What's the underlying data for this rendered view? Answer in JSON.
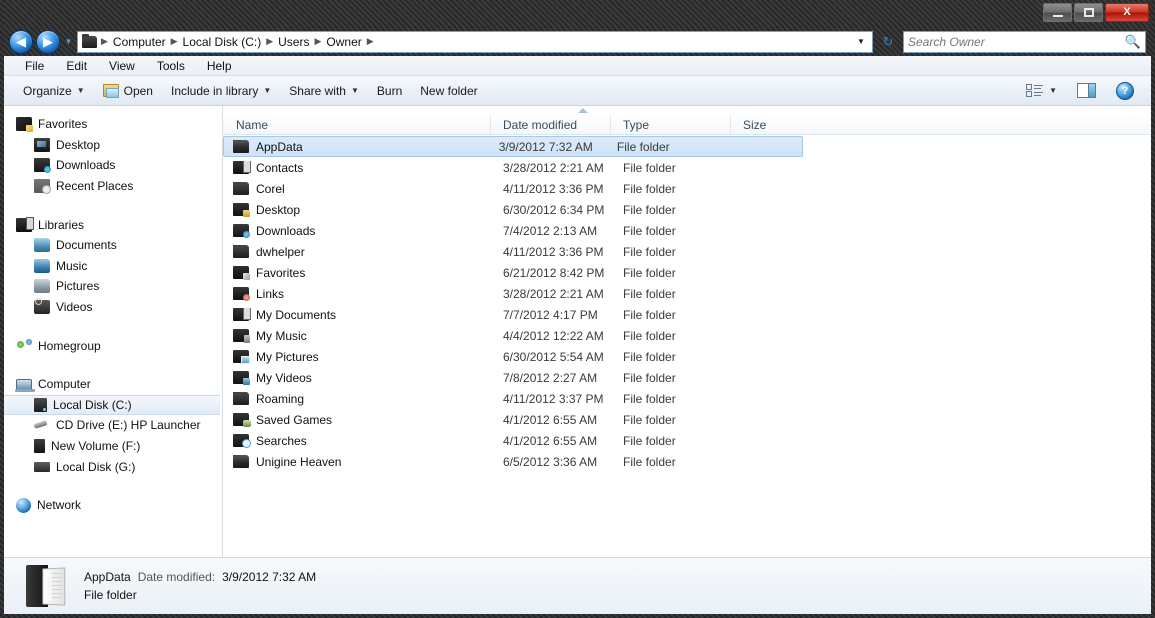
{
  "window": {
    "minimize_label": "Minimize",
    "maximize_label": "Maximize",
    "close_label": "X"
  },
  "address_bar": {
    "back_label": "◀",
    "forward_label": "▶",
    "history_caret": "▼",
    "crumbs": [
      "Computer",
      "Local Disk (C:)",
      "Users",
      "Owner"
    ],
    "separator": "▶",
    "dropdown_caret": "▼",
    "refresh_label": "↻"
  },
  "search": {
    "placeholder": "Search Owner",
    "value": "",
    "icon": "search-icon"
  },
  "menu": {
    "items": [
      "File",
      "Edit",
      "View",
      "Tools",
      "Help"
    ]
  },
  "toolbar": {
    "organize_label": "Organize",
    "open_label": "Open",
    "include_label": "Include in library",
    "share_label": "Share with",
    "burn_label": "Burn",
    "new_folder_label": "New folder",
    "caret": "▼",
    "help_label": "?"
  },
  "sidebar": {
    "groups": [
      {
        "header": {
          "label": "Favorites",
          "icon": "favorites-icon"
        },
        "items": [
          {
            "label": "Desktop",
            "icon": "desktop-icon"
          },
          {
            "label": "Downloads",
            "icon": "downloads-icon"
          },
          {
            "label": "Recent Places",
            "icon": "recent-places-icon"
          }
        ]
      },
      {
        "header": {
          "label": "Libraries",
          "icon": "libraries-icon"
        },
        "items": [
          {
            "label": "Documents",
            "icon": "documents-icon"
          },
          {
            "label": "Music",
            "icon": "music-icon"
          },
          {
            "label": "Pictures",
            "icon": "pictures-icon"
          },
          {
            "label": "Videos",
            "icon": "videos-icon"
          }
        ]
      },
      {
        "header": {
          "label": "Homegroup",
          "icon": "homegroup-icon"
        },
        "items": []
      },
      {
        "header": {
          "label": "Computer",
          "icon": "computer-icon"
        },
        "items": [
          {
            "label": "Local Disk (C:)",
            "icon": "hard-disk-icon",
            "selected": true
          },
          {
            "label": "CD Drive (E:) HP Launcher",
            "icon": "cd-drive-icon"
          },
          {
            "label": "New Volume (F:)",
            "icon": "volume-icon"
          },
          {
            "label": "Local Disk (G:)",
            "icon": "hard-disk-icon"
          }
        ]
      },
      {
        "header": {
          "label": "Network",
          "icon": "network-icon"
        },
        "items": []
      }
    ]
  },
  "file_list": {
    "columns": [
      "Name",
      "Date modified",
      "Type",
      "Size"
    ],
    "sort_column": "Name",
    "sort_direction": "ascending",
    "rows": [
      {
        "name": "AppData",
        "date": "3/9/2012 7:32 AM",
        "type": "File folder",
        "size": "",
        "icon": "folder-plain-icon",
        "selected": true
      },
      {
        "name": "Contacts",
        "date": "3/28/2012 2:21 AM",
        "type": "File folder",
        "size": "",
        "icon": "folder-contacts-icon"
      },
      {
        "name": "Corel",
        "date": "4/11/2012 3:36 PM",
        "type": "File folder",
        "size": "",
        "icon": "folder-tint-icon"
      },
      {
        "name": "Desktop",
        "date": "6/30/2012 6:34 PM",
        "type": "File folder",
        "size": "",
        "icon": "folder-desktop-icon"
      },
      {
        "name": "Downloads",
        "date": "7/4/2012 2:13 AM",
        "type": "File folder",
        "size": "",
        "icon": "folder-downloads-icon"
      },
      {
        "name": "dwhelper",
        "date": "4/11/2012 3:36 PM",
        "type": "File folder",
        "size": "",
        "icon": "folder-tint-icon"
      },
      {
        "name": "Favorites",
        "date": "6/21/2012 8:42 PM",
        "type": "File folder",
        "size": "",
        "icon": "folder-favorites-icon"
      },
      {
        "name": "Links",
        "date": "3/28/2012 2:21 AM",
        "type": "File folder",
        "size": "",
        "icon": "folder-links-icon"
      },
      {
        "name": "My Documents",
        "date": "7/7/2012 4:17 PM",
        "type": "File folder",
        "size": "",
        "icon": "folder-documents-icon"
      },
      {
        "name": "My Music",
        "date": "4/4/2012 12:22 AM",
        "type": "File folder",
        "size": "",
        "icon": "folder-music-icon"
      },
      {
        "name": "My Pictures",
        "date": "6/30/2012 5:54 AM",
        "type": "File folder",
        "size": "",
        "icon": "folder-pictures-icon"
      },
      {
        "name": "My Videos",
        "date": "7/8/2012 2:27 AM",
        "type": "File folder",
        "size": "",
        "icon": "folder-videos-icon"
      },
      {
        "name": "Roaming",
        "date": "4/11/2012 3:37 PM",
        "type": "File folder",
        "size": "",
        "icon": "folder-tint-icon"
      },
      {
        "name": "Saved Games",
        "date": "4/1/2012 6:55 AM",
        "type": "File folder",
        "size": "",
        "icon": "folder-games-icon"
      },
      {
        "name": "Searches",
        "date": "4/1/2012 6:55 AM",
        "type": "File folder",
        "size": "",
        "icon": "folder-search-icon"
      },
      {
        "name": "Unigine Heaven",
        "date": "6/5/2012 3:36 AM",
        "type": "File folder",
        "size": "",
        "icon": "folder-plain-icon"
      }
    ]
  },
  "details_pane": {
    "name": "AppData",
    "date_label": "Date modified:",
    "date_value": "3/9/2012 7:32 AM",
    "type": "File folder",
    "icon": "folder-large-icon"
  },
  "colors": {
    "selection": "#cfe3f7",
    "selection_border": "#a8c8e8",
    "accent": "#2f7fd0",
    "close_button": "#cf3322"
  }
}
